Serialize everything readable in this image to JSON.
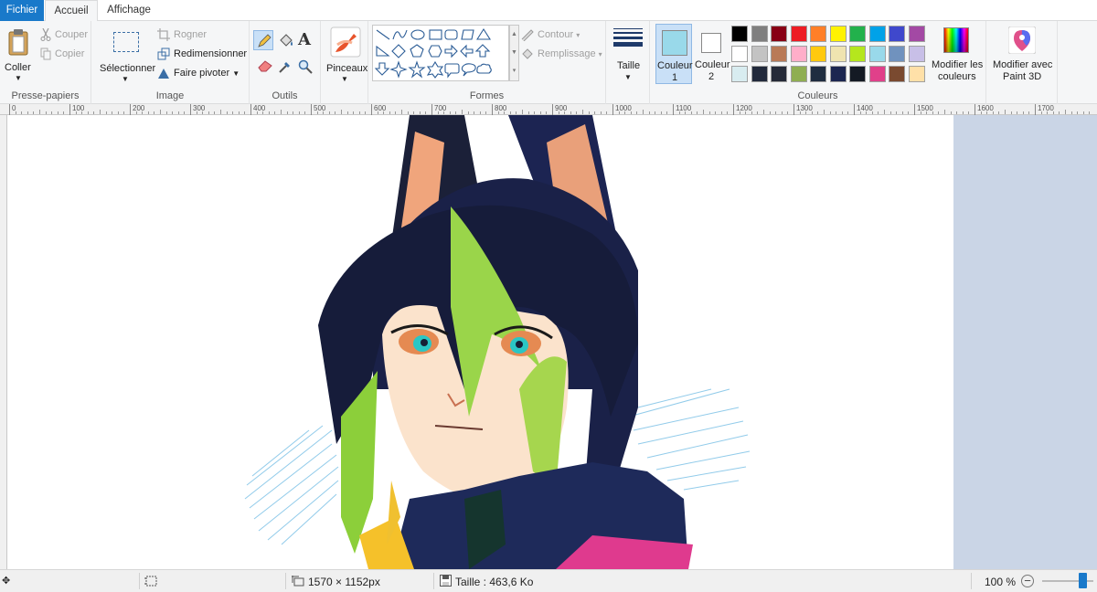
{
  "tabs": {
    "file": "Fichier",
    "home": "Accueil",
    "view": "Affichage"
  },
  "clipboard": {
    "paste": "Coller",
    "cut": "Couper",
    "copy": "Copier",
    "label": "Presse-papiers"
  },
  "image": {
    "select": "Sélectionner",
    "crop": "Rogner",
    "resize": "Redimensionner",
    "rotate": "Faire pivoter",
    "label": "Image"
  },
  "tools": {
    "label": "Outils"
  },
  "brushes": {
    "label": "Pinceaux"
  },
  "shapes": {
    "outline": "Contour",
    "fill": "Remplissage",
    "label": "Formes"
  },
  "size": {
    "label": "Taille"
  },
  "colors": {
    "color1_l1": "Couleur",
    "color1_l2": "1",
    "color2_l1": "Couleur",
    "color2_l2": "2",
    "edit_l1": "Modifier les",
    "edit_l2": "couleurs",
    "label": "Couleurs",
    "color1_value": "#99d9ea",
    "color2_value": "#ffffff",
    "palette_row1": [
      "#000000",
      "#7f7f7f",
      "#880015",
      "#ed1c24",
      "#ff7f27",
      "#fff200",
      "#22b14c",
      "#00a2e8",
      "#3f48cc",
      "#a349a4"
    ],
    "palette_row2": [
      "#ffffff",
      "#c3c3c3",
      "#b97a57",
      "#ffaec9",
      "#ffc90e",
      "#efe4b0",
      "#b5e61d",
      "#99d9ea",
      "#7092be",
      "#c8bfe7"
    ],
    "palette_row3": [
      "#d8ecf0",
      "#222a3c",
      "#252a38",
      "#8fae52",
      "#1f2d40",
      "#1c2650",
      "#141a24",
      "#e0408a",
      "#7a4a30",
      "#ffe0a8"
    ]
  },
  "paint3d": {
    "l1": "Modifier avec",
    "l2": "Paint 3D"
  },
  "ruler": [
    "0",
    "100",
    "200",
    "300",
    "400",
    "500",
    "600",
    "700",
    "800",
    "900",
    "1000",
    "1100",
    "1200",
    "1300",
    "1400",
    "1500",
    "1600",
    "1700"
  ],
  "status": {
    "dimensions": "1570 × 1152px",
    "size": "Taille : 463,6 Ko",
    "zoom": "100 %"
  }
}
